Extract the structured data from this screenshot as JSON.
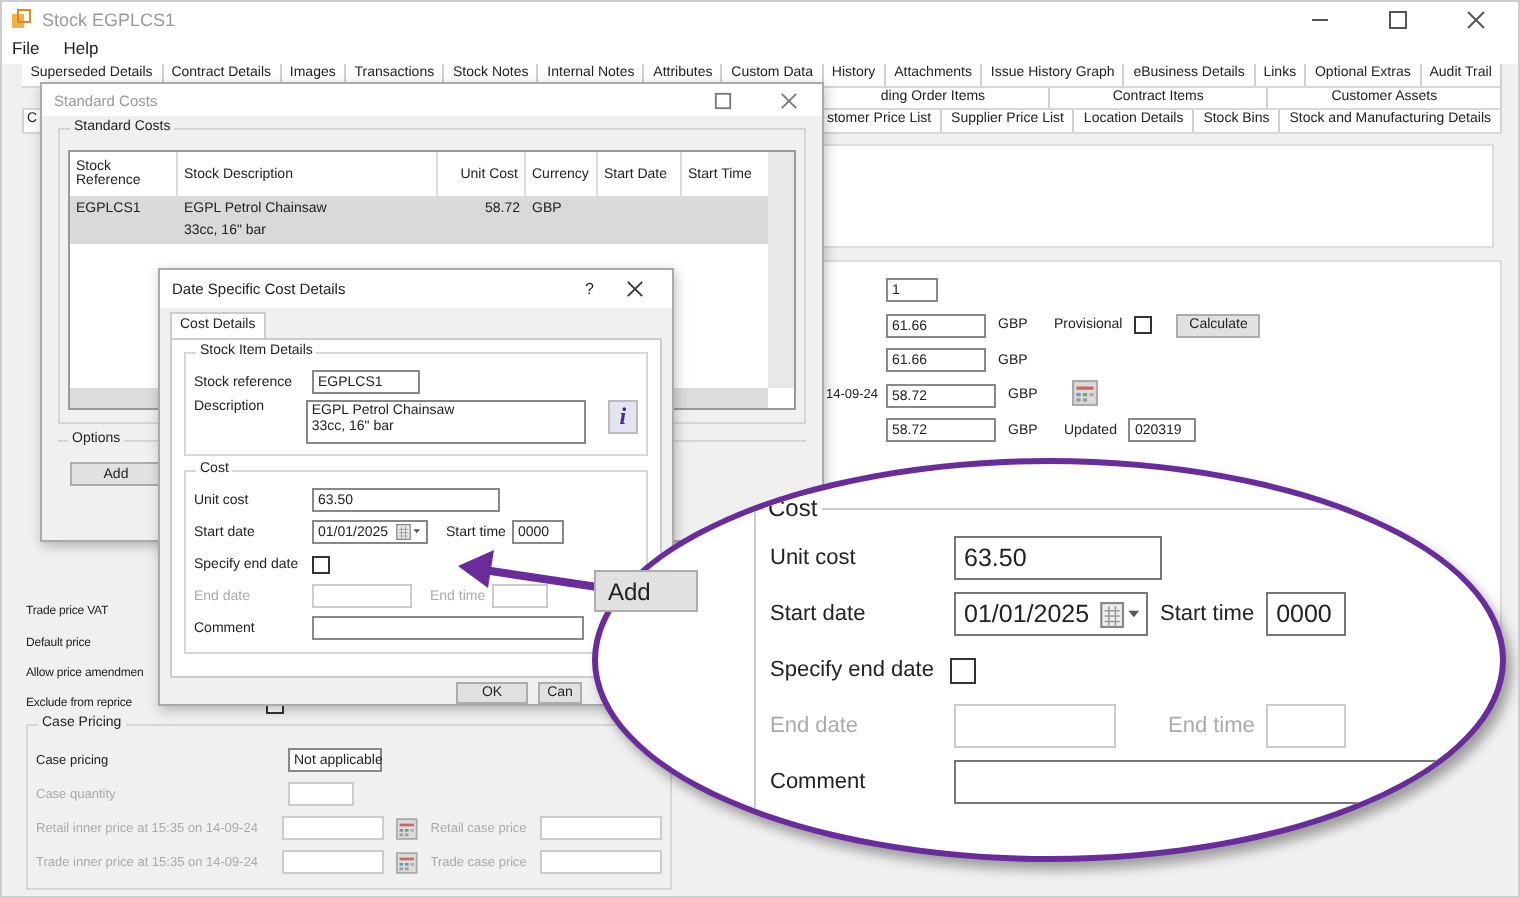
{
  "main_window": {
    "title": "Stock EGPLCS1",
    "menu": [
      "File",
      "Help"
    ],
    "tab_rows": [
      [
        "Superseded Details",
        "Contract Details",
        "Images",
        "Transactions",
        "Stock Notes",
        "Internal Notes",
        "Attributes",
        "Custom Data",
        "History",
        "Attachments",
        "Issue History Graph",
        "eBusiness Details",
        "Links",
        "Optional Extras",
        "Audit Trail"
      ],
      [
        "ding Order Items",
        "Contract Items",
        "Customer Assets"
      ],
      [
        "stomer Price List",
        "Supplier Price List",
        "Location Details",
        "Stock Bins",
        "Stock and Manufacturing Details"
      ]
    ],
    "row_3_fragment": "C",
    "price_rows": [
      {
        "value": "1"
      },
      {
        "value": "61.66",
        "currency": "GBP",
        "checkbox_label": "Provisional",
        "checked": false,
        "button": "Calculate"
      },
      {
        "value": "61.66",
        "currency": "GBP"
      },
      {
        "label": "14-09-24",
        "value": "58.72",
        "currency": "GBP",
        "calendar": true
      },
      {
        "value": "58.72",
        "currency": "GBP",
        "updated_label": "Updated",
        "updated_value": "020319"
      }
    ],
    "left_rows": [
      {
        "label": "Trade price VAT"
      },
      {
        "label": "Default price"
      },
      {
        "label": "Allow price amendmen"
      },
      {
        "label": "Exclude from reprice",
        "checked": false
      }
    ],
    "case_pricing": {
      "title": "Case Pricing",
      "case_pricing_label": "Case pricing",
      "case_pricing_value": "Not applicable",
      "quantity_label": "Case quantity",
      "disabled": true,
      "price_rows": [
        {
          "label": "Retail inner price at 15:35 on 14-09-24",
          "case_label": "Retail case price"
        },
        {
          "label": "Trade inner price at 15:35 on 14-09-24",
          "case_label": "Trade case price"
        }
      ]
    }
  },
  "standard_costs": {
    "title": "Standard Costs",
    "group_label": "Standard Costs",
    "columns": [
      "Stock Reference",
      "Stock Description",
      "Unit Cost",
      "Currency",
      "Start Date",
      "Start Time"
    ],
    "rows": [
      {
        "reference": "EGPLCS1",
        "description": "EGPL Petrol Chainsaw",
        "description_line_2": "33cc, 16\" bar",
        "unit_cost": "58.72",
        "currency": "GBP",
        "selected": true
      }
    ],
    "options_label": "Options",
    "add_button": "Add"
  },
  "magnified_add_button": "Add",
  "cost_dialog": {
    "title": "Date Specific Cost Details",
    "help": "?",
    "tab": "Cost Details",
    "stock_group": "Stock Item Details",
    "stock_reference_label": "Stock reference",
    "stock_reference": "EGPLCS1",
    "description_label": "Description",
    "description": "EGPL Petrol Chainsaw\n33cc, 16\" bar",
    "info_button": "i",
    "cost_group": "Cost",
    "unit_cost_label": "Unit cost",
    "unit_cost": "63.50",
    "start_date_label": "Start date",
    "start_date": "01/01/2025",
    "start_time_label": "Start time",
    "start_time": "0000",
    "specify_end_label": "Specify end date",
    "specify_end": false,
    "end_date_label": "End date",
    "end_time_label": "End time",
    "comment_label": "Comment",
    "buttons": [
      "OK",
      "Can"
    ]
  },
  "callout": {
    "cost_group": "Cost",
    "unit_cost_label": "Unit cost",
    "unit_cost": "63.50",
    "start_date_label": "Start date",
    "start_date": "01/01/2025",
    "start_time_label": "Start time",
    "start_time": "0000",
    "specify_end_label": "Specify end date",
    "specify_end": false,
    "end_date_label": "End date",
    "end_time_label": "End time",
    "comment_label": "Comment"
  }
}
